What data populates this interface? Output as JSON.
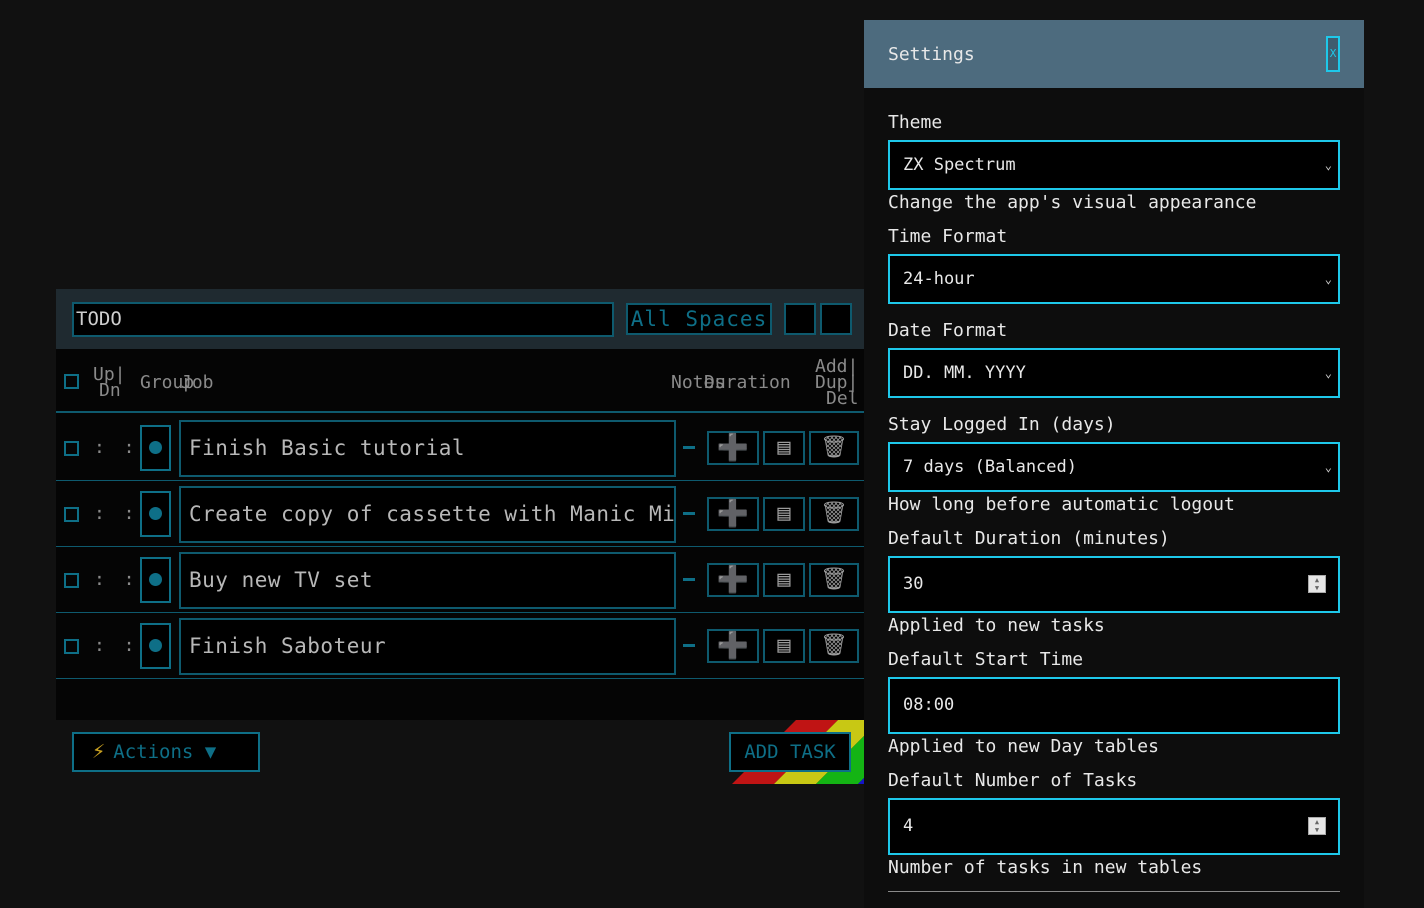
{
  "todo": {
    "title_value": "TODO",
    "spaces_label": "All Spaces",
    "headers": {
      "updn_1": "Up|",
      "updn_2": "Dn",
      "group": "Group",
      "job": "Job",
      "notes": "Notes",
      "duration": "Duration",
      "adddupdel_1": "Add|",
      "adddupdel_2": "Dup|",
      "adddupdel_3": "Del"
    },
    "rows": [
      {
        "job": "Finish Basic tutorial"
      },
      {
        "job": "Create copy of cassette with Manic Miner"
      },
      {
        "job": "Buy new TV set"
      },
      {
        "job": "Finish Saboteur"
      }
    ],
    "drag_handle": ":  :",
    "add_icon": "➕",
    "dup_icon": "▤",
    "del_icon": "🗑",
    "actions_label": "Actions ▼",
    "actions_icon": "⚡",
    "add_task_label": "ADD TASK",
    "colors": {
      "accent": "#0e6f87",
      "stripe_red": "#c01414",
      "stripe_yellow": "#c8c814",
      "stripe_green": "#14b414",
      "stripe_blue": "#1414c8"
    }
  },
  "settings": {
    "title": "Settings",
    "close_label": "X",
    "theme": {
      "label": "Theme",
      "value": "ZX Spectrum",
      "help": "Change the app's visual appearance"
    },
    "time_format": {
      "label": "Time Format",
      "value": "24-hour"
    },
    "date_format": {
      "label": "Date Format",
      "value": "DD. MM. YYYY"
    },
    "stay_logged_in": {
      "label": "Stay Logged In (days)",
      "value": "7 days (Balanced)",
      "help": "How long before automatic logout"
    },
    "default_duration": {
      "label": "Default Duration (minutes)",
      "value": "30",
      "help": "Applied to new tasks"
    },
    "default_start_time": {
      "label": "Default Start Time",
      "value": "08:00",
      "help": "Applied to new Day tables"
    },
    "default_num_tasks": {
      "label": "Default Number of Tasks",
      "value": "4",
      "help": "Number of tasks in new tables"
    },
    "colors": {
      "header_bg": "#4d6b7e",
      "field_border": "#1ec8ea"
    }
  }
}
